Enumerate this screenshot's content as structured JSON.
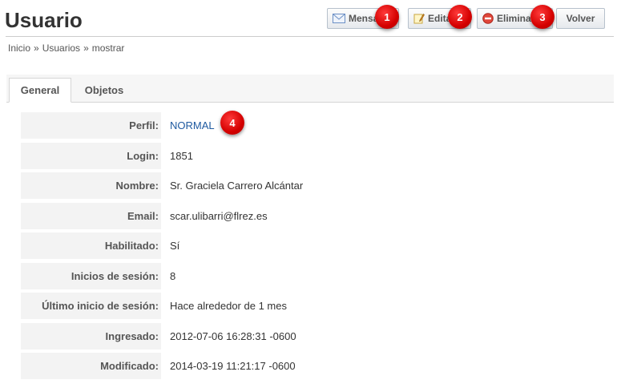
{
  "header": {
    "title": "Usuario",
    "actions": {
      "message_label": "Mensaje",
      "edit_label": "Editar",
      "delete_label": "Eliminar",
      "back_label": "Volver"
    }
  },
  "badges": [
    "1",
    "2",
    "3",
    "4"
  ],
  "breadcrumb": {
    "items": [
      "Inicio",
      "Usuarios",
      "mostrar"
    ],
    "separator": "»"
  },
  "tabs": [
    "General",
    "Objetos"
  ],
  "details": [
    {
      "label": "Perfil:",
      "value": "NORMAL"
    },
    {
      "label": "Login:",
      "value": "1851"
    },
    {
      "label": "Nombre:",
      "value": "Sr. Graciela Carrero Alcántar"
    },
    {
      "label": "Email:",
      "value": "scar.ulibarri@flrez.es"
    },
    {
      "label": "Habilitado:",
      "value": "Sí"
    },
    {
      "label": "Inicios de sesión:",
      "value": "8"
    },
    {
      "label": "Último inicio de sesión:",
      "value": "Hace alrededor de 1 mes"
    },
    {
      "label": "Ingresado:",
      "value": "2012-07-06 16:28:31 -0600"
    },
    {
      "label": "Modificado:",
      "value": "2014-03-19 11:21:17 -0600"
    }
  ],
  "icons": {
    "message": "envelope-icon",
    "edit": "pencil-note-icon",
    "delete": "no-entry-icon"
  },
  "colors": {
    "badge": "#d40000",
    "link": "#1f5aa0"
  }
}
